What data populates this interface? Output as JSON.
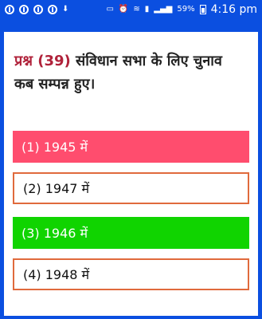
{
  "status": {
    "battery_pct": "59%",
    "time": "4:16 pm"
  },
  "question": {
    "label": "प्रश्न (39)",
    "text": "संविधान सभा के लिए चुनाव कब सम्पन्न हुए।"
  },
  "options": [
    {
      "label": "(1) 1945 में",
      "state": "wrong"
    },
    {
      "label": "(2) 1947 में",
      "state": "neutral"
    },
    {
      "label": "(3) 1946 में",
      "state": "correct"
    },
    {
      "label": "(4) 1948 में",
      "state": "neutral"
    }
  ],
  "colors": {
    "background": "#0b4fe0",
    "wrong": "#ff4d6e",
    "correct": "#10d400",
    "outline": "#e06a3c",
    "question_label": "#b0223a"
  }
}
